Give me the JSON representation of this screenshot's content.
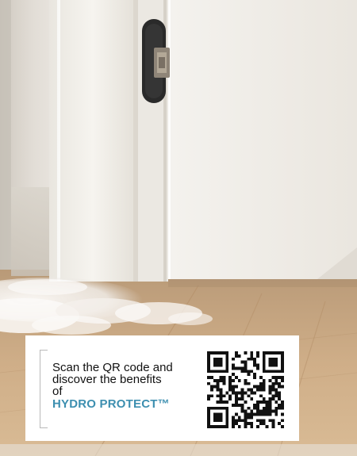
{
  "card": {
    "line1": "Scan the QR code and",
    "line2": "discover the benefits",
    "line3": "of",
    "brand": "HYDRO PROTECT™"
  },
  "icons": {
    "hinge": "concealed-hinge-icon",
    "qr": "qr-code-icon"
  },
  "colors": {
    "brand_accent": "#3d8fb0",
    "wall": "#e4e0d9",
    "door": "#f1efea",
    "floor": "#c9a57f",
    "hinge": "#2a2a2a"
  }
}
